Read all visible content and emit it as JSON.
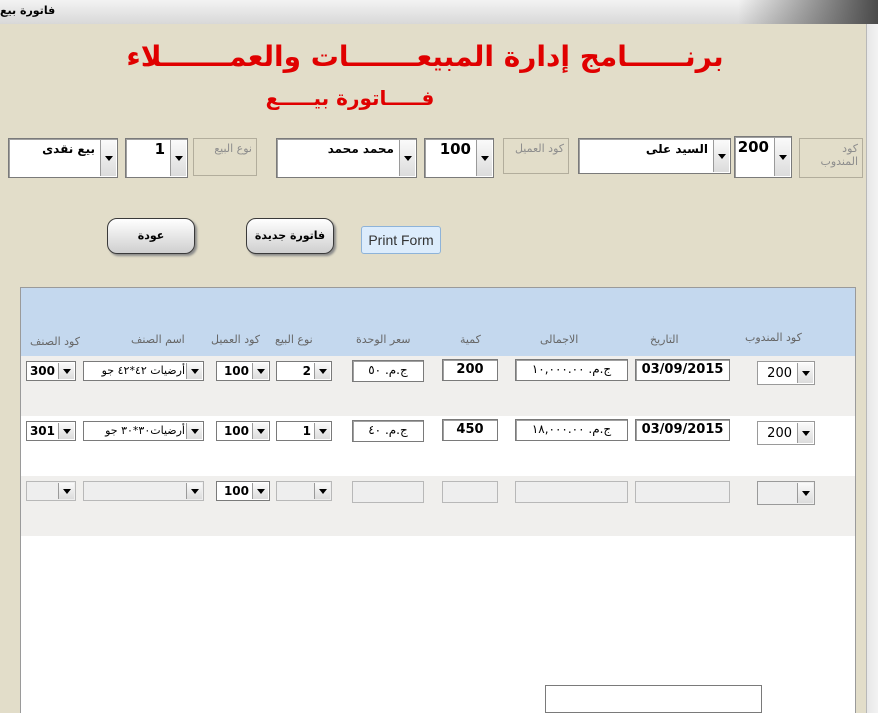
{
  "window": {
    "title": "فاتورة بيع"
  },
  "header": {
    "app_title": "برنــــــامج إدارة المبيعـــــــات والعمـــــــلاء",
    "form_title": "فـــــاتورة بيـــــع"
  },
  "fields": {
    "rep_code_label": "كود المندوب",
    "rep_code_value": "200",
    "rep_name_value": "السيد على",
    "customer_code_label": "كود العميل",
    "customer_code_value": "100",
    "customer_name_value": "محمد محمد",
    "sale_type_label": "نوع البيع",
    "sale_type_value": "1",
    "sale_type_name_value": "بيع نقدى"
  },
  "buttons": {
    "back": "عودة",
    "new_invoice": "فاتورة جديدة",
    "print_form": "Print Form"
  },
  "grid": {
    "columns": {
      "rep_code": "كود المندوب",
      "date": "التاريخ",
      "total": "الاجمالى",
      "qty": "كمية",
      "unit_price": "سعر الوحدة",
      "sale_type": "نوع البيع",
      "customer_code": "كود العميل",
      "item_name": "اسم الصنف",
      "item_code": "كود الصنف"
    },
    "rows": [
      {
        "rep_code": "200",
        "date": "03/09/2015",
        "total": "ج.م. ١٠,٠٠٠.٠٠",
        "qty": "200",
        "unit_price": "ج.م. ٥٠",
        "sale_type": "2",
        "customer_code": "100",
        "item_name": "أرضيات ٤٢*٤٢ جو",
        "item_code": "300"
      },
      {
        "rep_code": "200",
        "date": "03/09/2015",
        "total": "ج.م. ١٨,٠٠٠.٠٠",
        "qty": "450",
        "unit_price": "ج.م. ٤٠",
        "sale_type": "1",
        "customer_code": "100",
        "item_name": "أرضيات٣٠*٣٠ جو",
        "item_code": "301"
      },
      {
        "rep_code": "",
        "date": "",
        "total": "",
        "qty": "",
        "unit_price": "",
        "sale_type": "",
        "customer_code": "100",
        "item_name": "",
        "item_code": ""
      }
    ]
  },
  "colors": {
    "form_background": "#e2ddc9",
    "title_red": "#e00000",
    "grid_header": "#c4d8ee",
    "row_alt": "#f0efed"
  }
}
